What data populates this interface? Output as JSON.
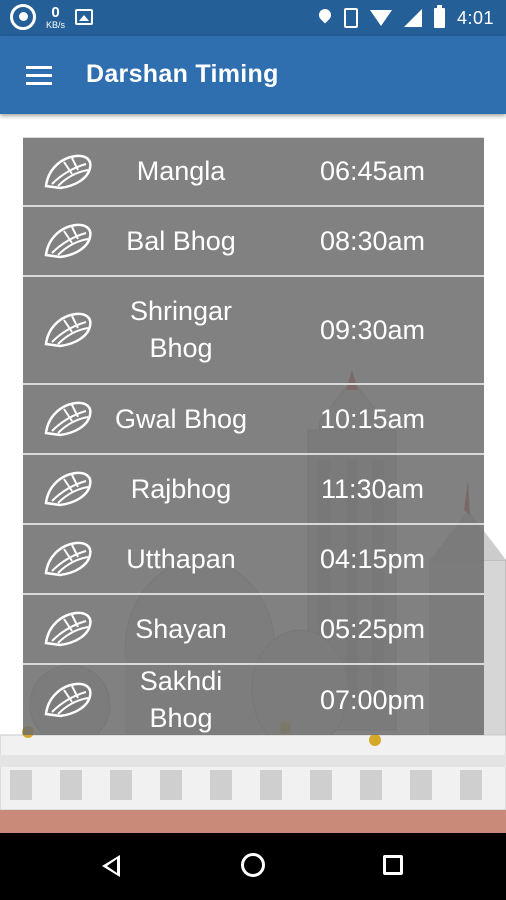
{
  "status_bar": {
    "network_speed_value": "0",
    "network_speed_unit": "KB/s",
    "time": "4:01",
    "icons": [
      "whatsapp-icon",
      "image-icon",
      "location-icon",
      "vibrate-icon",
      "wifi-icon",
      "signal-icon",
      "battery-icon"
    ]
  },
  "app_bar": {
    "menu_icon": "hamburger-menu-icon",
    "title": "Darshan Timing"
  },
  "timings": [
    {
      "name": "Mangla",
      "time": "06:45am"
    },
    {
      "name": "Bal Bhog",
      "time": "08:30am"
    },
    {
      "name": "Shringar Bhog",
      "time": "09:30am"
    },
    {
      "name": "Gwal Bhog",
      "time": "10:15am"
    },
    {
      "name": "Rajbhog",
      "time": "11:30am"
    },
    {
      "name": "Utthapan",
      "time": "04:15pm"
    },
    {
      "name": "Shayan",
      "time": "05:25pm"
    },
    {
      "name": "Sakhdi Bhog",
      "time": "07:00pm"
    }
  ],
  "colors": {
    "status_bar": "#255f98",
    "app_bar": "#2f6fb0",
    "row_background": "#707070",
    "row_divider": "#d9d9d9",
    "text": "#ffffff"
  },
  "nav_bar": {
    "icons": [
      "back-icon",
      "home-icon",
      "recents-icon"
    ]
  }
}
